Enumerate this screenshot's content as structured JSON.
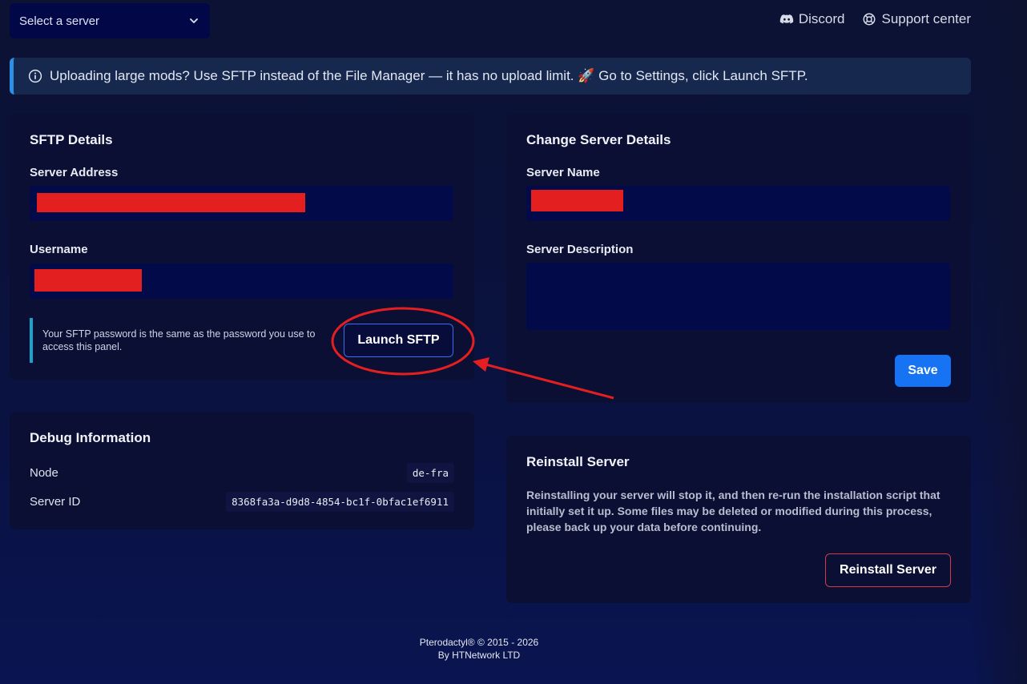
{
  "topbar": {
    "server_select_placeholder": "Select a server",
    "links": [
      {
        "icon": "discord-icon",
        "label": "Discord"
      },
      {
        "icon": "lifebuoy-icon",
        "label": "Support center"
      }
    ]
  },
  "banner": {
    "icon": "info-icon",
    "text": "Uploading large mods? Use SFTP instead of the File Manager — it has no upload limit. 🚀 Go to Settings, click Launch SFTP."
  },
  "sftp": {
    "title": "SFTP Details",
    "server_address_label": "Server Address",
    "username_label": "Username",
    "password_note": "Your SFTP password is the same as the password you use to access this panel.",
    "launch_label": "Launch SFTP"
  },
  "debug": {
    "title": "Debug Information",
    "rows": [
      {
        "label": "Node",
        "value": "de-fra"
      },
      {
        "label": "Server ID",
        "value": "8368fa3a-d9d8-4854-bc1f-0bfac1ef6911"
      }
    ]
  },
  "change": {
    "title": "Change Server Details",
    "name_label": "Server Name",
    "description_label": "Server Description",
    "save_label": "Save"
  },
  "reinstall": {
    "title": "Reinstall Server",
    "description": "Reinstalling your server will stop it, and then re-run the installation script that initially set it up. Some files may be deleted or modified during this process, please back up your data before continuing.",
    "button_label": "Reinstall Server"
  },
  "footer": {
    "line1": "Pterodactyl® © 2015 - 2026",
    "line2": "By HTNetwork LTD"
  },
  "colors": {
    "accent": "#1673f4",
    "danger": "#d23a4a",
    "annotation": "#e41f1f"
  }
}
